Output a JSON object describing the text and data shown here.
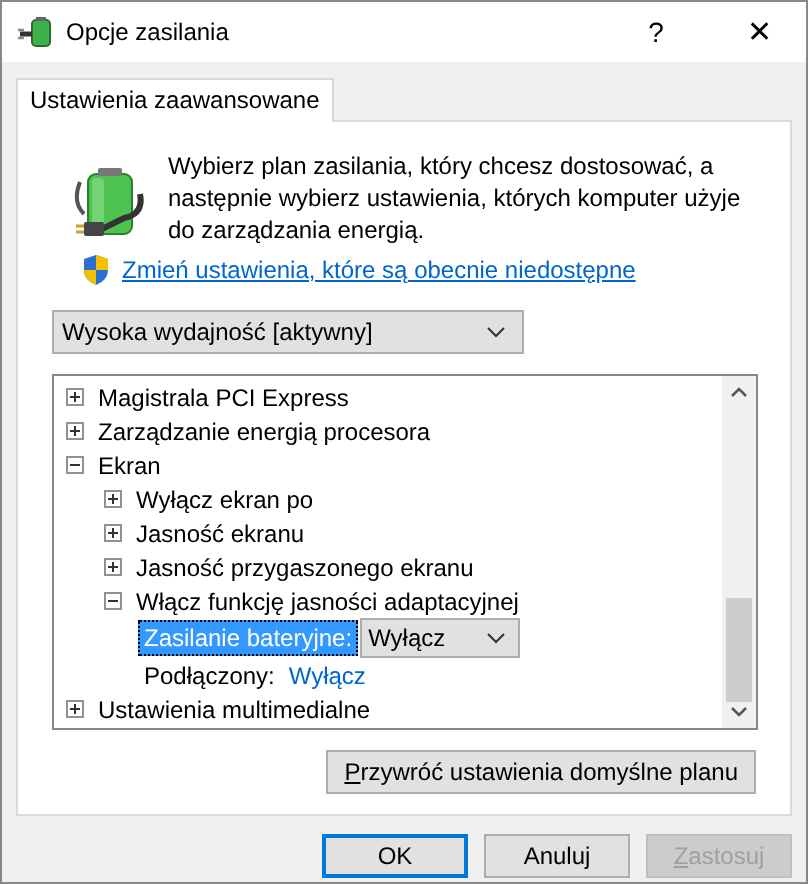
{
  "window": {
    "title": "Opcje zasilania",
    "help": "?",
    "close": "✕"
  },
  "tabs": [
    {
      "label": "Ustawienia zaawansowane",
      "selected": true
    }
  ],
  "intro": "Wybierz plan zasilania, który chcesz dostosować, a następnie wybierz ustawienia, których komputer użyje do zarządzania energią.",
  "admin_link": "Zmień ustawienia, które są obecnie niedostępne",
  "plan_select": {
    "value": "Wysoka wydajność [aktywny]"
  },
  "tree": [
    {
      "kind": "node",
      "label": "Magistrala PCI Express",
      "expanded": false
    },
    {
      "kind": "node",
      "label": "Zarządzanie energią procesora",
      "expanded": false
    },
    {
      "kind": "node",
      "label": "Ekran",
      "expanded": true,
      "children": [
        {
          "kind": "node",
          "label": "Wyłącz ekran po",
          "expanded": false
        },
        {
          "kind": "node",
          "label": "Jasność ekranu",
          "expanded": false
        },
        {
          "kind": "node",
          "label": "Jasność przygaszonego ekranu",
          "expanded": false
        },
        {
          "kind": "node",
          "label": "Włącz funkcję jasności adaptacyjnej",
          "expanded": true,
          "children": [
            {
              "kind": "dropdown",
              "label": "Zasilanie bateryjne:",
              "value": "Wyłącz",
              "selected": true
            },
            {
              "kind": "link",
              "label": "Podłączony:",
              "value": "Wyłącz",
              "selected": false
            }
          ]
        }
      ]
    },
    {
      "kind": "node",
      "label": "Ustawienia multimedialne",
      "expanded": false
    }
  ],
  "restore_button": {
    "label": "Przywróć ustawienia domyślne planu",
    "underline_first": true
  },
  "buttons": [
    {
      "label": "OK",
      "default": true,
      "disabled": false,
      "underline_first": false
    },
    {
      "label": "Anuluj",
      "default": false,
      "disabled": false,
      "underline_first": false
    },
    {
      "label": "Zastosuj",
      "default": false,
      "disabled": true,
      "underline_first": true
    }
  ]
}
